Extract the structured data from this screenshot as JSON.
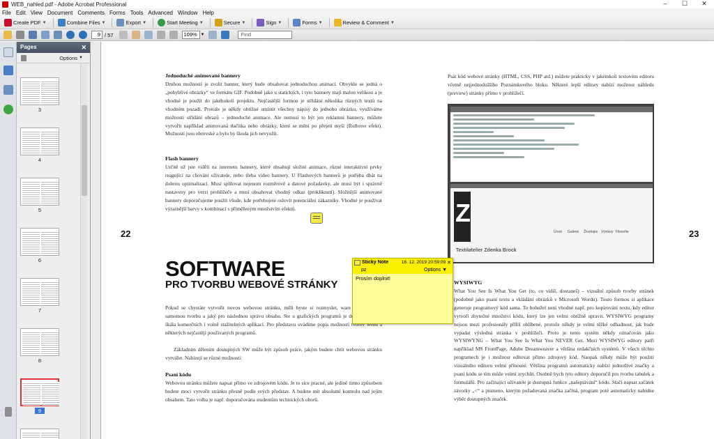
{
  "window": {
    "title": "WEB_nahled.pdf - Adobe Acrobat Professional"
  },
  "menu": [
    "File",
    "Edit",
    "View",
    "Document",
    "Comments",
    "Forms",
    "Tools",
    "Advanced",
    "Window",
    "Help"
  ],
  "toolbar": {
    "create_pdf": "Create PDF",
    "combine": "Combine Files",
    "export": "Export",
    "start_meeting": "Start Meeting",
    "secure": "Secure",
    "sign": "Sign",
    "forms": "Forms",
    "review": "Review & Comment"
  },
  "nav": {
    "current_page": "9",
    "page_count": "/ 57",
    "zoom": "109%",
    "find_placeholder": "Find"
  },
  "pages_panel": {
    "title": "Pages",
    "options": "Options",
    "thumbnails": [
      "3",
      "4",
      "5",
      "6",
      "7",
      "8",
      "9"
    ],
    "selected": "9"
  },
  "document": {
    "page_left": "22",
    "page_right": "23",
    "h_anim": "Jednoduché animované bannery",
    "p_anim": "Druhou možností je zvolit banner, který bude obsahovat jednoduchou animaci. Obvykle se jedná o „pohyblivé obrázky“ ve formátu GIF. Podobně jako u statických, i tyto bannery mají malou velikost a je vhodné je použít do jakéhokoli projektu. Nejčastější formou je střídání několika různých textů na vhodném pozadí. Protože je někdy obtížné umístit všechny nápisy do jednoho obrázku, využíváme možnosti střídání obrazů – jednoduché animace. Ale nemusí to být jen reklamní bannery, můžete vytvořit například animovaná tlačítka nebo obrázky, které se mění po přejetí myší (Rollover efekt). Možností jsou obrovské a bylo by škoda jich nevyužít.",
    "h_flash": "Flash bannery",
    "p_flash": "Určitě už jste viděli na internetu bannery, které obsahují složité animace, různé interaktivní prvky reagující na chování uživatele, nebo třeba video bannery. U Flashových bannerů je potřeba dbát na dobrou optimalizaci. Musí splňovat nejenom rozměrové a datové požadavky, ale musí být i správně nastaveny pro verzi prohlížeče a musí obsahovat vhodný odkaz (prokliknutí). Složitější animované bannery doporučujeme použít všude, kde potřebujete oslovit potenciální zákazníky. Vhodné je používat výraznější barvy v kombinaci s přiměřeným množstvím efektů.",
    "big_title": "SOFTWARE",
    "sub_title": "PRO TVORBU WEBOVÉ STRÁNKY",
    "p_software": "Pokud se chystáte vytvořit novou webovou stránku, měli byste si rozmyslet, ware použijete pro samotnou tvorbu a jaký pro následnou správu obsahu. Ste u grafických programů je dostupná široká škála komerčních i volně stažitelných aplikací. Pro představu uvádíme popis možností tvorby webu a některých nejčastějí používaných programů.",
    "p_zakladnim": "Základním dělením dostupných SW může být způsob práce, jakým budete chtít webovou stránku vytvářet. Nabízejí se různé možnosti:",
    "h_psani": "Psaní kódu",
    "p_psani": "Webovou stránku můžete napsat přímo ve zdrojovém kódu. Je to sice pracné, ale jedině tímto způsobem budete moci vytvořit stránku přesně podle svých představ. A budete mít absolutní kontrolu nad jejím obsahem. Tato volba je např. doporučována studentům technických oborů.",
    "p_right_top": "Psát kód webové stránky (HTML, CSS, PHP atd.) můžete prakticky v jakémkoli textovém editoru včetně nejjednoduššího Poznámkového bloku. Některé lepší editory nabízí možnost náhledu (preview) stránky přímo v prohlížeči.",
    "h_wysiwyg": "WYSIWYG",
    "p_wysiwyg": "What You See Is What You Get (to, co vidíš, dostaneš) – vizuální způsob tvorby stránek (podobně jako psaní textu a vkládání obrázků v Microsoft Wordu). Touto formou si aplikace generuje programový kód sama. To bohužel není vhodné např. pro kopírování textu, kdy editor vytvoří zbytečné množství kódu, který lze jen velmi obtížně upravit. WYSIWYG programy nejsou mezi profesionály příliš oblíbené, protože někdy je velmi těžké odhadnout, jak bude vypadat výsledná stránka v prohlížeči. Proto je tento systém někdy označován jako WYSIWYNG – What You See Is What You NEVER Get. Mezi WYSIWYG editory patří například MS FrontPage, Adobe Dreamweaver a většina redakčních systémů. V všech těchto programech je i možnost editovat přímo zdrojový kód. Naopak někdy může být použití vizuálního editoru velmi přínosné. Většina programů automaticky nabízí jednotlivé značky a psaní kódu se tím může velmi zrychlit. Osobně bych tyto editory doporučil pro tvorbu tabulek a formulářů. Pro začínající uživatele je dostupná funkce „našeptávání“ kódu. Stačí napsat začátek závorky „<“ a písmeno, kterým požadovaná značka začíná, program poté automaticky nabídne výběr dostupných značek.",
    "screenshot": {
      "logo_text": "ATELIER",
      "site_title": "Textilatelier Zdenka Brock",
      "nav": [
        "Úvod",
        "Galerie",
        "Životopis",
        "Výstavy",
        "Filosofie"
      ]
    }
  },
  "sticky_note": {
    "title": "Sticky Note",
    "date": "16. 12. 2019 20:59:09",
    "author": "pz",
    "options": "Options",
    "text": "Prosím doplnit!"
  }
}
